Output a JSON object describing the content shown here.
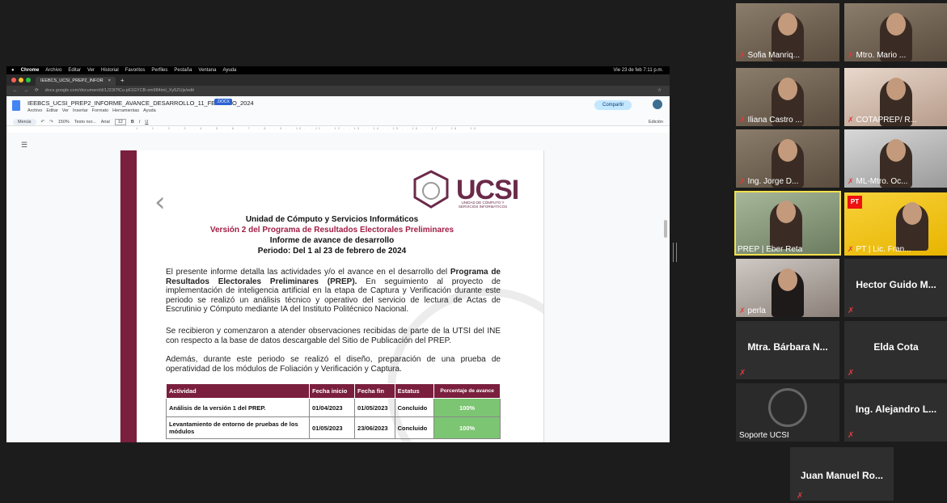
{
  "mac_menu": {
    "app": "Chrome",
    "items": [
      "Archivo",
      "Editar",
      "Ver",
      "Historial",
      "Favoritos",
      "Perfiles",
      "Pestaña",
      "Ventana",
      "Ayuda"
    ],
    "clock": "Vie 23 de feb 7:11 p.m."
  },
  "browser": {
    "tab_title": "IEEBCS_UCSI_PREP2_INFOR",
    "url": "docs.google.com/document/d/1J23l7fCu-p61GYCB-xm984iml_Xy5ZUjs/edit"
  },
  "doc": {
    "title": "IEEBCS_UCSI_PREP2_INFORME_AVANCE_DESARROLLO_11_FEBRERO_2024",
    "badge": ".DOCX",
    "menus": [
      "Archivo",
      "Editar",
      "Ver",
      "Insertar",
      "Formato",
      "Herramientas",
      "Ayuda"
    ],
    "share_label": "Compartir",
    "toolbar": {
      "menus": "Menús",
      "zoom": "150%",
      "style": "Texto nor...",
      "font": "Arial",
      "size": "12",
      "mode": "Edición"
    },
    "ruler": "1 . . 1 . . 2 . . 3 . . 4 . . 5 . . 6 . . 7 . . 8 . . 9 . . 10 . . 11 . . 12 . . 13 . . 14 . . 15 . . 16 . . 17 . . 18 . . 19",
    "logo": {
      "text": "UCSI",
      "sub": "UNIDAD DE CÓMPUTO Y SERVICIOS INFORMÁTICOS"
    },
    "heading1": "Unidad de Cómputo y Servicios Informáticos",
    "heading2": "Versión 2 del Programa de Resultados Electorales Preliminares",
    "heading3": "Informe de avance de desarrollo",
    "heading4": "Periodo: Del 1 al 23 de febrero de 2024",
    "p1_a": "El presente informe detalla las actividades y/o el avance en el desarrollo del ",
    "p1_b": "Programa de Resultados Electorales Preliminares (PREP).",
    "p1_c": " En seguimiento al proyecto de implementación de inteligencia artificial en la etapa de Captura y Verificación durante este periodo se realizó un análisis técnico y operativo del servicio de lectura de Actas de Escrutinio y Cómputo mediante IA del Instituto Politécnico Nacional.",
    "p2": "Se recibieron y comenzaron a atender observaciones recibidas de parte de la UTSI del INE con respecto a la base de datos descargable del Sitio de Publicación del PREP.",
    "p3": "Además, durante este periodo se realizó el diseño, preparación de una prueba de operatividad de los módulos de Foliación y Verificación y Captura.",
    "table": {
      "headers": [
        "Actividad",
        "Fecha inicio",
        "Fecha fin",
        "Estatus",
        "Porcentaje de avance"
      ],
      "rows": [
        [
          "Análisis de la versión 1 del PREP.",
          "01/04/2023",
          "01/05/2023",
          "Concluido",
          "100%"
        ],
        [
          "Levantamiento de entorno de pruebas de los módulos",
          "01/05/2023",
          "23/06/2023",
          "Concluido",
          "100%"
        ]
      ]
    }
  },
  "participants": [
    {
      "name": "Sofia Manriq...",
      "type": "video"
    },
    {
      "name": "Mtro. Mario ...",
      "type": "video"
    },
    {
      "name": "Iliana Castro ...",
      "type": "video"
    },
    {
      "name": "COTAPREP/ R...",
      "type": "video"
    },
    {
      "name": "Ing. Jorge D...",
      "type": "video"
    },
    {
      "name": "ML-Mtro. Oc...",
      "type": "video"
    },
    {
      "name": "PREP | Eber Reta",
      "type": "video"
    },
    {
      "name": "PT | Lic. Fran...",
      "type": "video"
    },
    {
      "name": "perla",
      "type": "video"
    },
    {
      "name": "Hector Guido M...",
      "type": "name"
    },
    {
      "name": "Mtra. Bárbara N...",
      "type": "name"
    },
    {
      "name": "Elda Cota",
      "type": "name"
    },
    {
      "name": "Soporte UCSI",
      "type": "video"
    },
    {
      "name": "Ing. Alejandro L...",
      "type": "name"
    },
    {
      "name": "Juan Manuel Ro...",
      "type": "name"
    }
  ],
  "pt_logo": "PT",
  "colors": {
    "brand": "#7a1f3d",
    "accent_red": "#a01e46",
    "status_green": "#7cc572",
    "share": "#c2e7ff",
    "active_speaker": "#f2e04a"
  }
}
